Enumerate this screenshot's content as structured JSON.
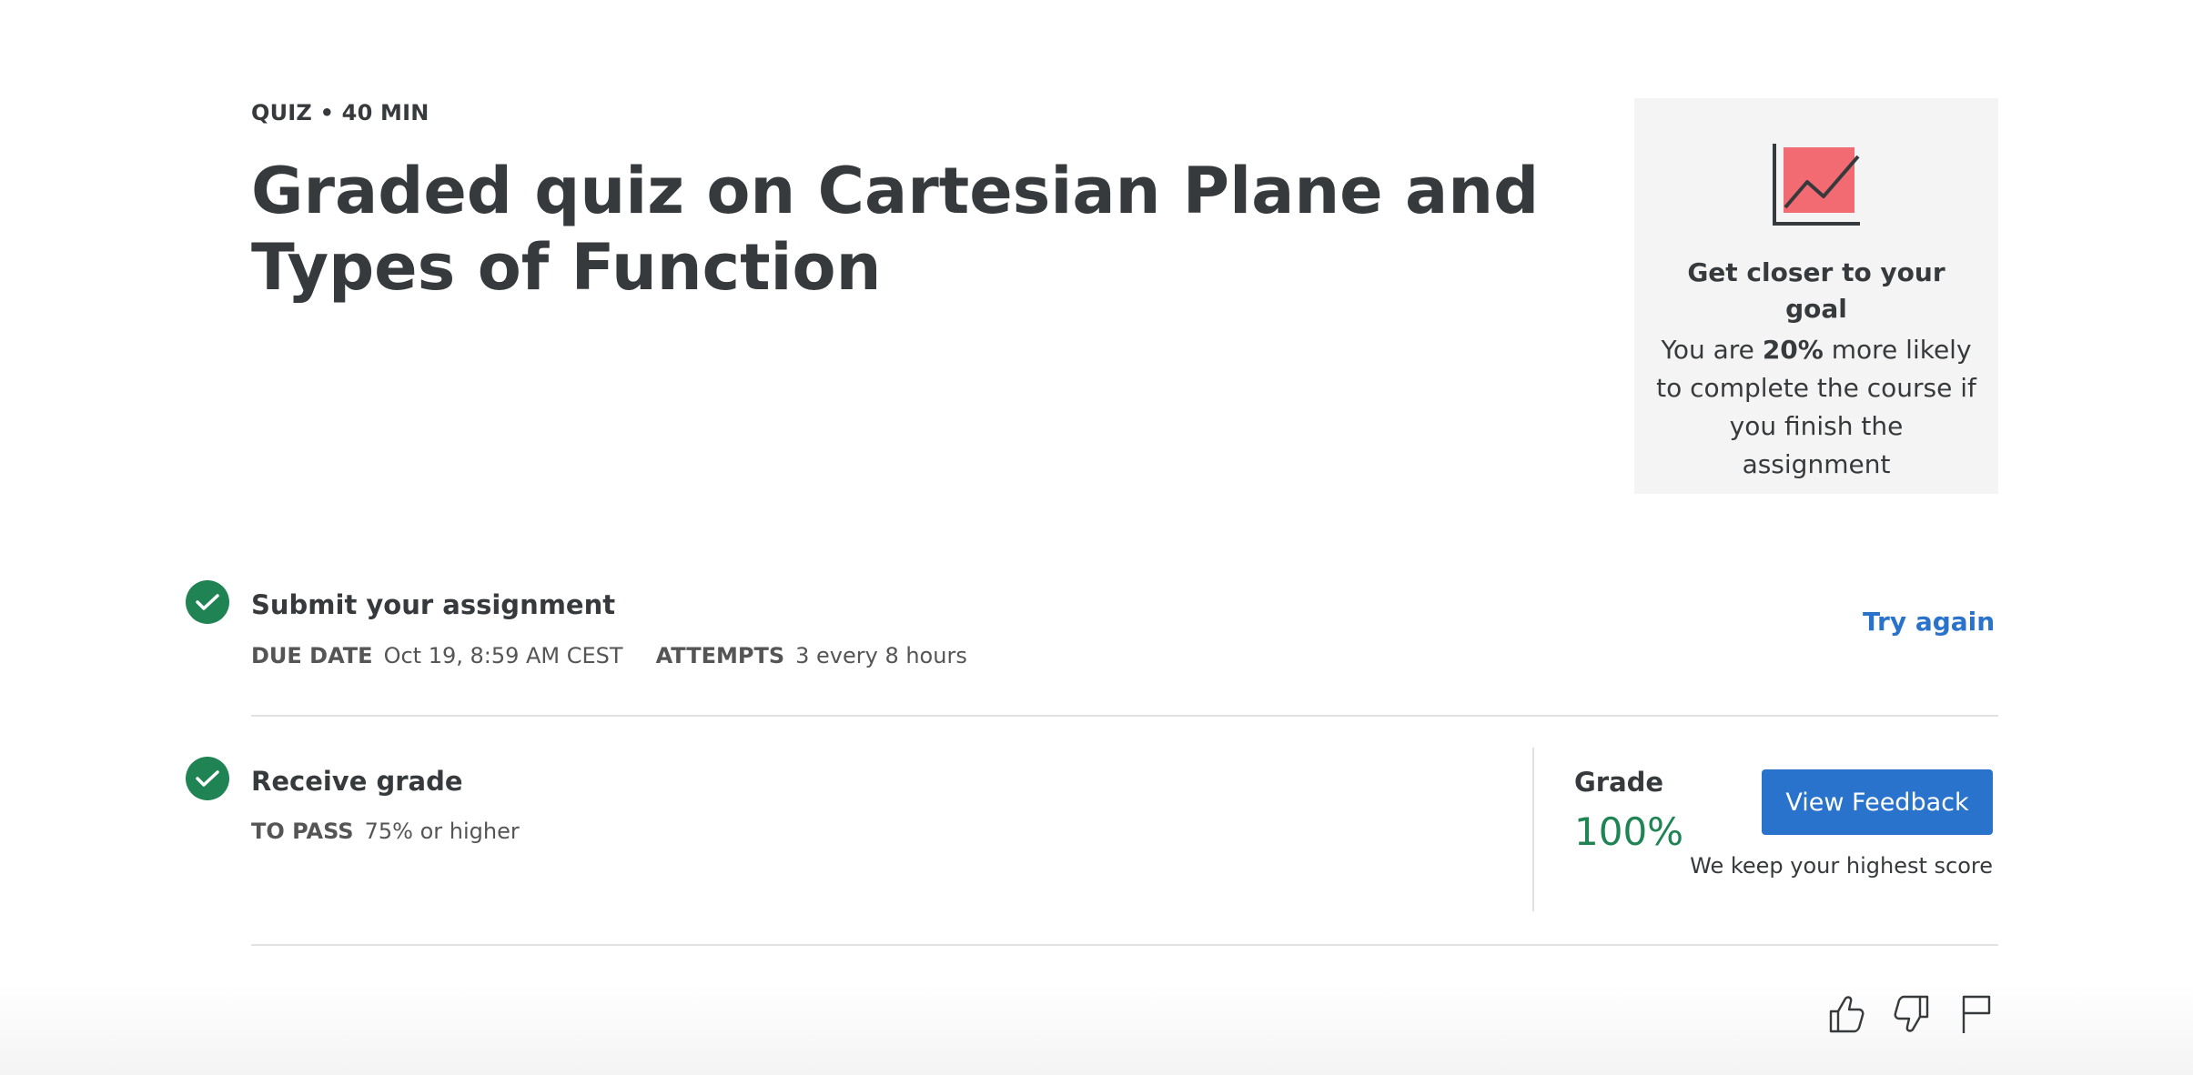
{
  "header": {
    "eyebrow": "QUIZ • 40 MIN",
    "title": "Graded quiz on Cartesian Plane and Types of Function"
  },
  "goal_card": {
    "icon": "line-chart-icon",
    "heading": "Get closer to your goal",
    "text_prefix": "You are ",
    "text_bold": "20%",
    "text_suffix": " more likely to complete the course if you finish the assignment"
  },
  "submit": {
    "title": "Submit your assignment",
    "due_label": "DUE DATE",
    "due_value": "Oct 19, 8:59 AM CEST",
    "attempts_label": "ATTEMPTS",
    "attempts_value": "3 every 8 hours",
    "try_again": "Try again"
  },
  "receive": {
    "title": "Receive grade",
    "pass_label": "TO PASS",
    "pass_value": "75% or higher",
    "grade_label": "Grade",
    "grade_value": "100%",
    "feedback_button": "View Feedback",
    "keep_score": "We keep your highest score"
  },
  "footer_icons": [
    "thumbs-up-icon",
    "thumbs-down-icon",
    "flag-icon"
  ],
  "colors": {
    "accent": "#2a73cc",
    "success": "#1f8354",
    "chart_fill": "#f26b72",
    "text": "#373a3c",
    "card_bg": "#f4f4f4"
  }
}
